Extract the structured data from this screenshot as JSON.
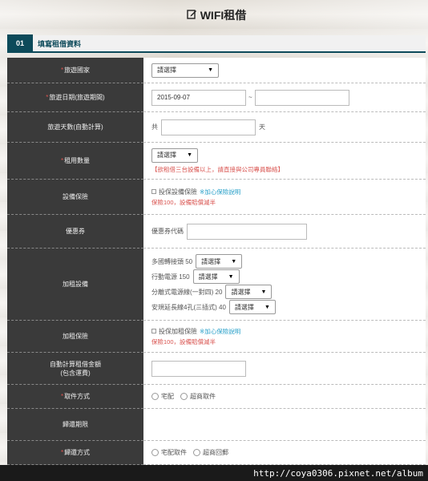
{
  "header": {
    "title": "WIFI租借",
    "icon": "edit-icon"
  },
  "section": {
    "number": "01",
    "title": "填寫租借資料"
  },
  "rows": {
    "country": {
      "label": "旅遊國家",
      "select": "請選擇"
    },
    "dates": {
      "label": "旅遊日期(旅遊期間)",
      "start": "2015-09-07",
      "sep": "~",
      "end": ""
    },
    "days": {
      "label": "旅遊天數(自動計算)",
      "prefix": "共",
      "suffix": "天",
      "value": ""
    },
    "qty": {
      "label": "租用數量",
      "select": "請選擇",
      "note": "【欲租借三台設備以上，請直接與公司專員聯絡】"
    },
    "insurance": {
      "label": "設備保險",
      "option": "投保設備保險",
      "link": "※加心保險說明",
      "price": "保險100，設備賠償減半"
    },
    "coupon": {
      "label": "優惠券",
      "placeholder_label": "優惠券代碼",
      "value": ""
    },
    "addons": {
      "label": "加租設備",
      "items": [
        {
          "text": "多國轉接頭 50",
          "select": "請選擇"
        },
        {
          "text": "行動電源 150",
          "select": "請選擇"
        },
        {
          "text": "分離式電源線(一對四) 20",
          "select": "請選擇"
        },
        {
          "text": "安規延長線4孔(三插式) 40",
          "select": "請選擇"
        }
      ]
    },
    "addon_insurance": {
      "label": "加租保險",
      "option": "投保加租保險",
      "link": "※加心保險說明",
      "price": "保險100，設備賠償減半"
    },
    "total": {
      "label_line1": "自動計算租借金額",
      "label_line2": "(包含運費)",
      "value": ""
    },
    "pickup": {
      "label": "取件方式",
      "options": [
        "宅配",
        "超商取件"
      ]
    },
    "return_period": {
      "label": "歸還期限"
    },
    "return_method": {
      "label": "歸還方式",
      "options": [
        "宅配取件",
        "超商回郵"
      ]
    }
  },
  "watermark": "http://coya0306.pixnet.net/album"
}
